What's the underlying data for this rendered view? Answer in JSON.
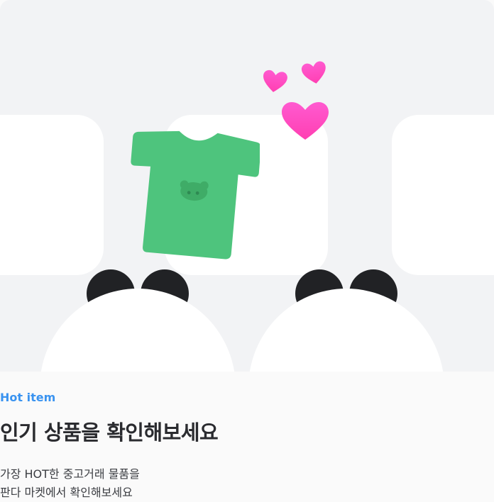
{
  "promo": {
    "eyebrow": "Hot item",
    "title": "인기 상품을 확인해보세요",
    "description_line1": "가장 HOT한 중고거래 물품을",
    "description_line2": "판다 마켓에서 확인해보세요"
  },
  "colors": {
    "hero_background": "#f2f3f5",
    "eyebrow": "#3a93f0",
    "title": "#2a2b2f",
    "shirt": "#4ec47d",
    "heart": "#ff4fc6",
    "panda_ear": "#212225"
  },
  "icons": [
    "tshirt-icon",
    "heart-icon",
    "panda-icon"
  ]
}
